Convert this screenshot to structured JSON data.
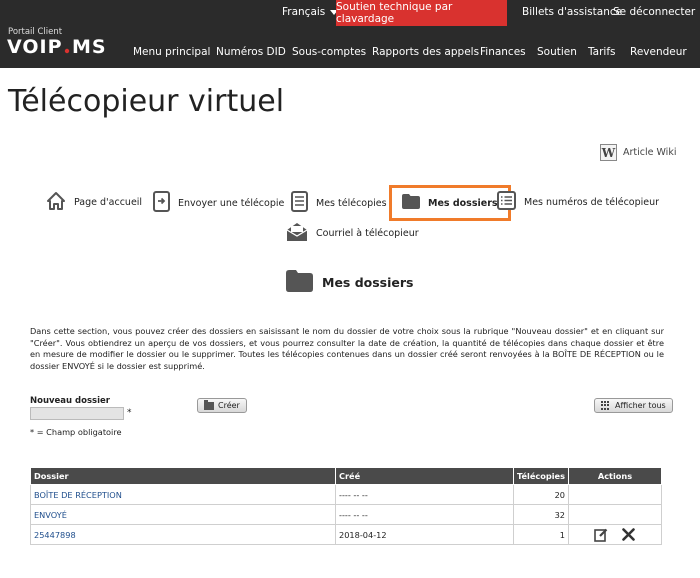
{
  "header": {
    "language": "Français",
    "support_button": "Soutien technique par clavardage",
    "tickets": "Billets d'assistance",
    "logout": "Se déconnecter",
    "portal_label": "Portail Client",
    "logo_text": "VOIP.MS",
    "nav": [
      "Menu principal",
      "Numéros DID",
      "Sous-comptes",
      "Rapports des appels",
      "Finances",
      "Soutien",
      "Tarifs",
      "Revendeur"
    ]
  },
  "page": {
    "title": "Télécopieur virtuel",
    "wiki_label": "Article Wiki",
    "wiki_icon_letter": "W"
  },
  "menu": {
    "home": "Page d'accueil",
    "send": "Envoyer une télécopie",
    "faxes": "Mes télécopies",
    "folders": "Mes dossiers",
    "numbers": "Mes numéros de télécopieur",
    "email_to_fax": "Courriel à télécopieur",
    "active": "folders",
    "active_color": "#f07b2a"
  },
  "section": {
    "title": "Mes dossiers",
    "description": "Dans cette section, vous pouvez créer des dossiers en saisissant le nom du dossier de votre choix sous la rubrique \"Nouveau dossier\" et en cliquant sur \"Créer\". Vous obtiendrez un aperçu de vos dossiers, et vous pourrez consulter la date de création, la quantité de télécopies dans chaque dossier et être en mesure de modifier le dossier ou le supprimer. Toutes les télécopies contenues dans un dossier créé seront renvoyées à la BOÎTE DE RÉCEPTION ou le dossier ENVOYÉ si le dossier est supprimé."
  },
  "form": {
    "new_folder_label": "Nouveau dossier",
    "new_folder_value": "",
    "required_star": "*",
    "required_note": "* = Champ obligatoire",
    "create_button": "Créer",
    "show_all_button": "Afficher tous"
  },
  "table": {
    "headers": [
      "Dossier",
      "Créé",
      "Télécopies",
      "Actions"
    ],
    "rows": [
      {
        "folder": "BOÎTE DE RÉCEPTION",
        "created": "---- -- --",
        "count": "20"
      },
      {
        "folder": "ENVOYÉ",
        "created": "---- -- --",
        "count": "32"
      },
      {
        "folder": "25447898",
        "created": "2018-04-12",
        "count": "1"
      }
    ],
    "header_color": "#4a4a4a",
    "link_color": "#1f4e8c"
  },
  "colors": {
    "header_bg": "#2b2b2b",
    "support_bg": "#d9322f"
  }
}
